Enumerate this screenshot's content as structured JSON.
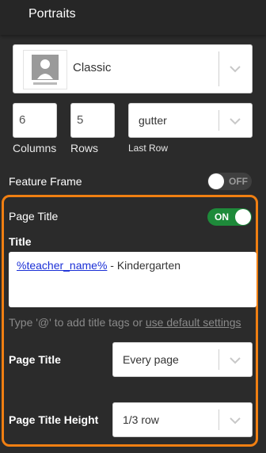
{
  "header": {
    "title": "Portraits"
  },
  "layout": {
    "selected": "Classic"
  },
  "grid": {
    "columns_value": "6",
    "columns_label": "Columns",
    "rows_value": "5",
    "rows_label": "Rows",
    "last_row_value": "gutter",
    "last_row_label": "Last Row"
  },
  "feature_frame": {
    "label": "Feature Frame",
    "toggle_text": "OFF",
    "enabled": false
  },
  "page_title": {
    "label": "Page Title",
    "toggle_text": "ON",
    "enabled": true,
    "title_label": "Title",
    "title_tag": "%teacher_name%",
    "title_suffix": " - Kindergarten",
    "helper_prefix": "Type '@' to add title tags or ",
    "helper_link": "use default settings",
    "frequency_label": "Page Title",
    "frequency_value": "Every page",
    "height_label": "Page Title Height",
    "height_value": "1/3 row"
  },
  "colors": {
    "accent_orange": "#f07f12",
    "toggle_on": "#1e8a3a",
    "toggle_off": "#3f3f3f",
    "panel_bg": "#2b2b2b",
    "link_blue": "#1a2fd6"
  },
  "icons": {
    "dropdown": "chevron-down-icon",
    "thumbnail": "portrait-thumbnail-icon"
  }
}
